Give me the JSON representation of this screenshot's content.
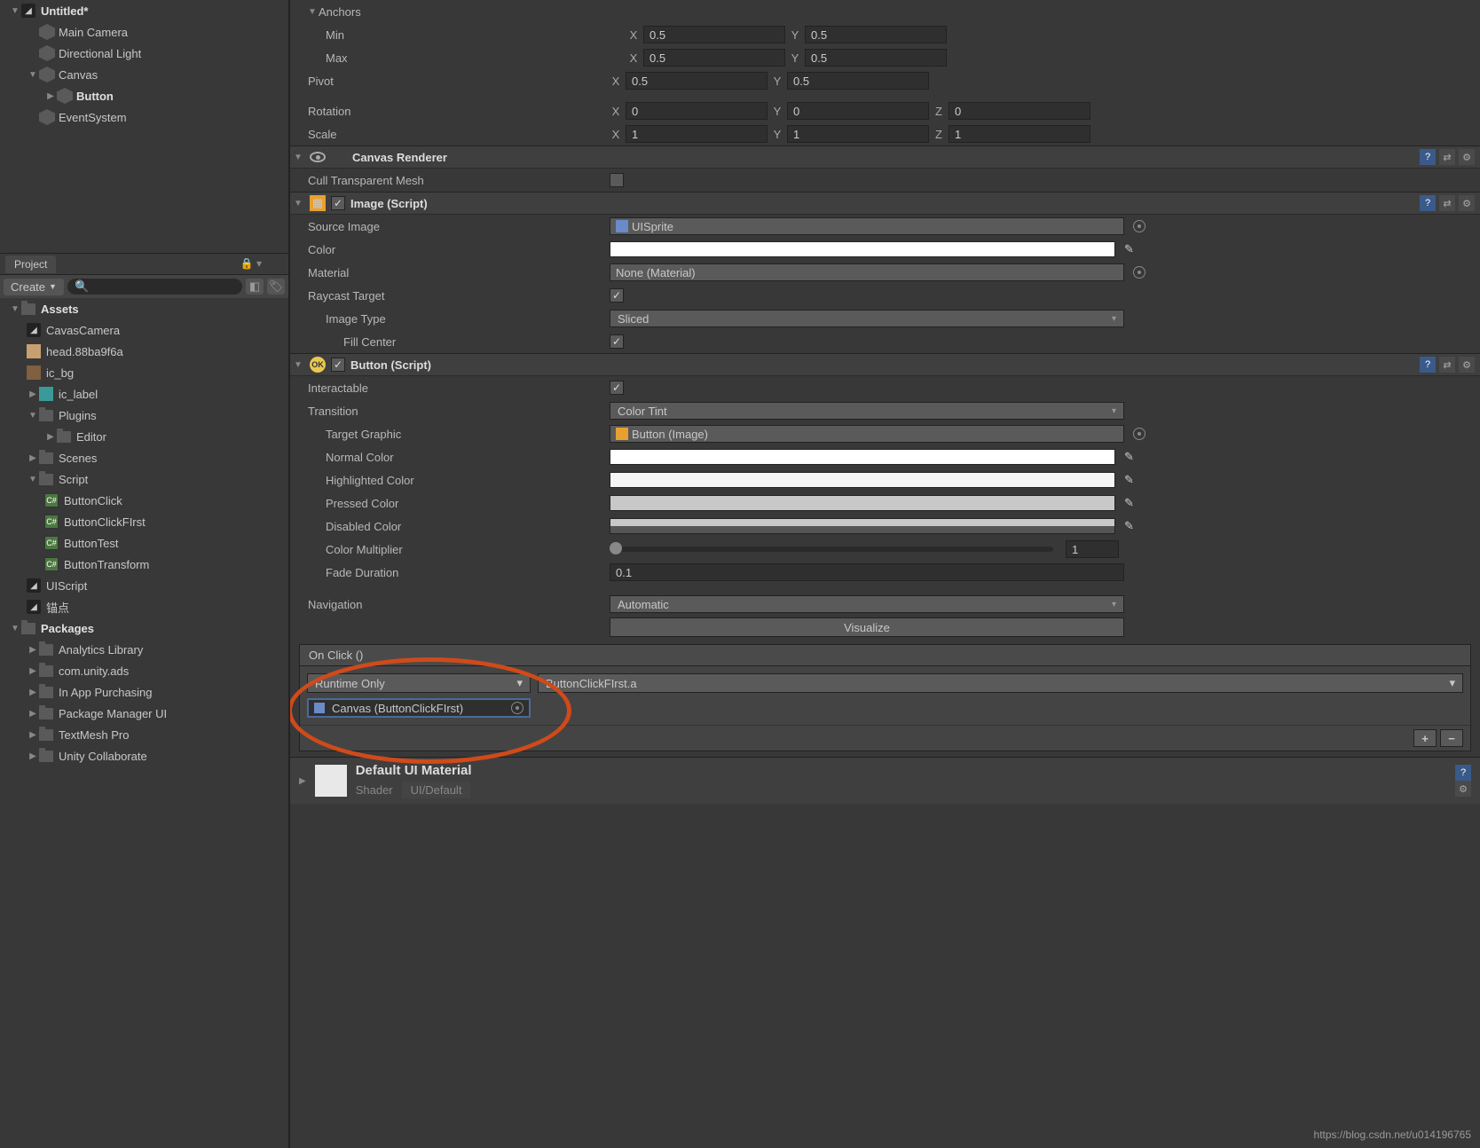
{
  "hierarchy": {
    "scene": "Untitled*",
    "items": [
      "Main Camera",
      "Directional Light",
      "Canvas",
      "Button",
      "EventSystem"
    ]
  },
  "project": {
    "tab": "Project",
    "create": "Create",
    "root": "Assets",
    "assets": [
      "CavasCamera",
      "head.88ba9f6a",
      "ic_bg",
      "ic_label",
      "Plugins",
      "Editor",
      "Scenes",
      "Script",
      "ButtonClick",
      "ButtonClickFIrst",
      "ButtonTest",
      "ButtonTransform",
      "UIScript",
      "锚点"
    ],
    "packages_label": "Packages",
    "packages": [
      "Analytics Library",
      "com.unity.ads",
      "In App Purchasing",
      "Package Manager UI",
      "TextMesh Pro",
      "Unity Collaborate"
    ]
  },
  "inspector": {
    "transform": {
      "anchors_label": "Anchors",
      "min_label": "Min",
      "min_x": "0.5",
      "min_y": "0.5",
      "max_label": "Max",
      "max_x": "0.5",
      "max_y": "0.5",
      "pivot_label": "Pivot",
      "pivot_x": "0.5",
      "pivot_y": "0.5",
      "rotation_label": "Rotation",
      "rot_x": "0",
      "rot_y": "0",
      "rot_z": "0",
      "scale_label": "Scale",
      "scale_x": "1",
      "scale_y": "1",
      "scale_z": "1"
    },
    "canvas_renderer": {
      "title": "Canvas Renderer",
      "cull_label": "Cull Transparent Mesh"
    },
    "image": {
      "title": "Image (Script)",
      "source_label": "Source Image",
      "source_value": "UISprite",
      "color_label": "Color",
      "material_label": "Material",
      "material_value": "None (Material)",
      "raycast_label": "Raycast Target",
      "imgtype_label": "Image Type",
      "imgtype_value": "Sliced",
      "fill_label": "Fill Center"
    },
    "button": {
      "title": "Button (Script)",
      "interactable_label": "Interactable",
      "transition_label": "Transition",
      "transition_value": "Color Tint",
      "target_label": "Target Graphic",
      "target_value": "Button (Image)",
      "normal_label": "Normal Color",
      "highlighted_label": "Highlighted Color",
      "pressed_label": "Pressed Color",
      "disabled_label": "Disabled Color",
      "multiplier_label": "Color Multiplier",
      "multiplier_value": "1",
      "fade_label": "Fade Duration",
      "fade_value": "0.1",
      "nav_label": "Navigation",
      "nav_value": "Automatic",
      "visualize": "Visualize",
      "onclick_label": "On Click ()",
      "runtime": "Runtime Only",
      "callback": "ButtonClickFIrst.a",
      "target_obj": "Canvas (ButtonClickFIrst)"
    },
    "material": {
      "title": "Default UI Material",
      "shader_label": "Shader",
      "shader_value": "UI/Default"
    }
  },
  "axes": {
    "x": "X",
    "y": "Y",
    "z": "Z"
  },
  "watermark": "https://blog.csdn.net/u014196765"
}
